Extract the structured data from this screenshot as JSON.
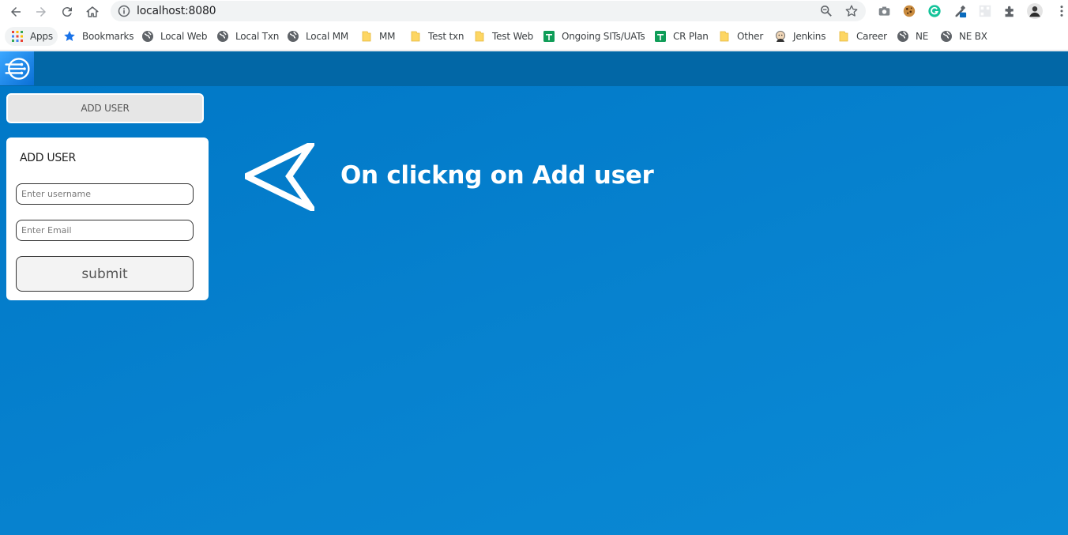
{
  "browser": {
    "url": "localhost:8080",
    "bookmarks": [
      {
        "label": "Apps",
        "icon": "apps-grid-icon"
      },
      {
        "label": "Bookmarks",
        "icon": "star-icon"
      },
      {
        "label": "Local Web",
        "icon": "globe-icon"
      },
      {
        "label": "Local Txn",
        "icon": "globe-icon"
      },
      {
        "label": "Local MM",
        "icon": "globe-icon"
      },
      {
        "label": "MM",
        "icon": "folder-icon"
      },
      {
        "label": "Test txn",
        "icon": "folder-icon"
      },
      {
        "label": "Test Web",
        "icon": "folder-icon"
      },
      {
        "label": "Ongoing SITs/UATs",
        "icon": "sheets-icon"
      },
      {
        "label": "CR Plan",
        "icon": "sheets-icon"
      },
      {
        "label": "Other",
        "icon": "folder-icon"
      },
      {
        "label": "Jenkins",
        "icon": "jenkins-icon"
      },
      {
        "label": "Career",
        "icon": "folder-icon"
      },
      {
        "label": "NE",
        "icon": "globe-icon"
      },
      {
        "label": "NE BX",
        "icon": "globe-icon"
      }
    ]
  },
  "app": {
    "add_user_button": "ADD USER",
    "panel_title": "ADD USER",
    "username_placeholder": "Enter username",
    "email_placeholder": "Enter Email",
    "submit_label": "submit",
    "annotation": "On clickng on Add user",
    "colors": {
      "background": "#0782cf",
      "topbar": "#0267a6",
      "annotation_text": "#ffffff"
    }
  }
}
